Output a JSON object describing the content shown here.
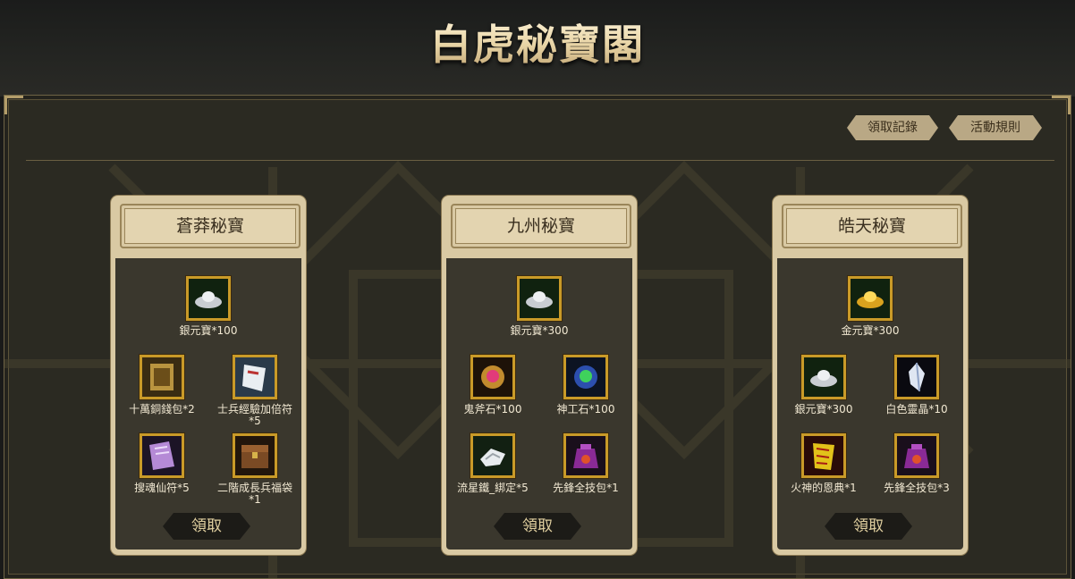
{
  "header": {
    "title": "白虎秘寶閣"
  },
  "toolbar": {
    "records_label": "領取記錄",
    "rules_label": "活動規則"
  },
  "panels": [
    {
      "title": "蒼莽秘寶",
      "claim_label": "領取",
      "items": [
        {
          "name": "銀元寶*100",
          "icon": "silver-ingot-icon"
        },
        {
          "name": "十萬銅錢包*2",
          "icon": "copper-coin-pouch-icon"
        },
        {
          "name": "士兵經驗加倍符\n*5",
          "icon": "exp-double-talisman-icon"
        },
        {
          "name": "搜魂仙符*5",
          "icon": "soul-search-talisman-icon"
        },
        {
          "name": "二階成長兵福袋\n*1",
          "icon": "growth-soldier-chest-icon"
        }
      ]
    },
    {
      "title": "九州秘寶",
      "claim_label": "領取",
      "items": [
        {
          "name": "銀元寶*300",
          "icon": "silver-ingot-icon"
        },
        {
          "name": "鬼斧石*100",
          "icon": "red-gem-stone-icon"
        },
        {
          "name": "神工石*100",
          "icon": "green-gem-stone-icon"
        },
        {
          "name": "流星鐵_綁定*5",
          "icon": "meteor-iron-icon"
        },
        {
          "name": "先鋒全技包*1",
          "icon": "skill-pouch-icon"
        }
      ]
    },
    {
      "title": "皓天秘寶",
      "claim_label": "領取",
      "items": [
        {
          "name": "金元寶*300",
          "icon": "gold-ingot-icon"
        },
        {
          "name": "銀元寶*300",
          "icon": "silver-ingot-icon"
        },
        {
          "name": "白色靈晶*10",
          "icon": "white-crystal-icon"
        },
        {
          "name": "火神的恩典*1",
          "icon": "fire-god-grace-icon"
        },
        {
          "name": "先鋒全技包*3",
          "icon": "skill-pouch-icon"
        }
      ]
    }
  ],
  "colors": {
    "background": "#2b2a22",
    "panel": "#d9c9a3",
    "panel_inner": "#3a372d",
    "icon_border": "#c99a28",
    "title_gold": "#efe2c0"
  }
}
